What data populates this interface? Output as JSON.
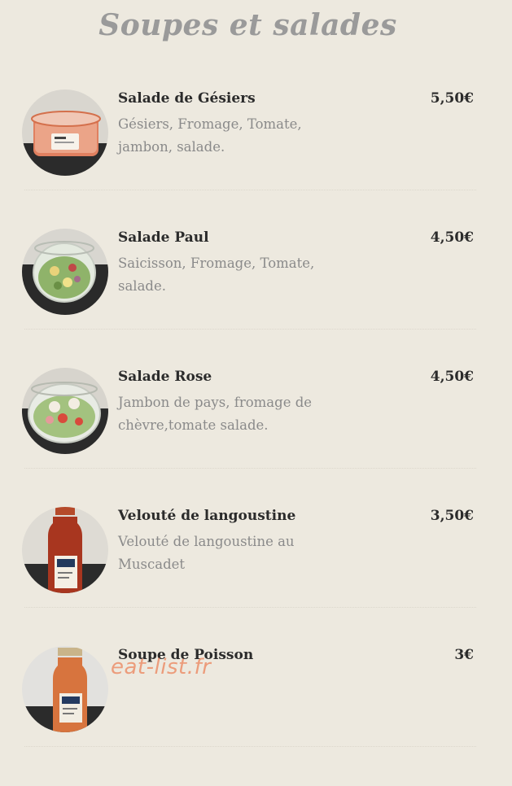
{
  "header": {
    "title": "Soupes et salades"
  },
  "items": [
    {
      "name": "Salade de Gésiers",
      "description": "Gésiers, Fromage, Tomate, jambon, salade.",
      "price": "5,50€",
      "image_icon": "salad-jar-photo-icon"
    },
    {
      "name": "Salade Paul",
      "description": "Saicisson, Fromage, Tomate, salade.",
      "price": "4,50€",
      "image_icon": "salad-jar-photo-icon"
    },
    {
      "name": "Salade Rose",
      "description": "Jambon de pays, fromage de chèvre,tomate salade.",
      "price": "4,50€",
      "image_icon": "salad-jar-photo-icon"
    },
    {
      "name": "Velouté de langoustine",
      "description": "Velouté de langoustine au Muscadet",
      "price": "3,50€",
      "image_icon": "soup-bottle-photo-icon"
    },
    {
      "name": "Soupe de Poisson",
      "description": "",
      "price": "3€",
      "image_icon": "soup-bottle-photo-icon"
    }
  ],
  "watermark": {
    "text": "eat-list.fr"
  },
  "colors": {
    "background": "#ede9df",
    "title": "#9a9a9a",
    "name_text": "#2b2b2b",
    "description_text": "#8a8a8a",
    "watermark": "#eb825a"
  }
}
